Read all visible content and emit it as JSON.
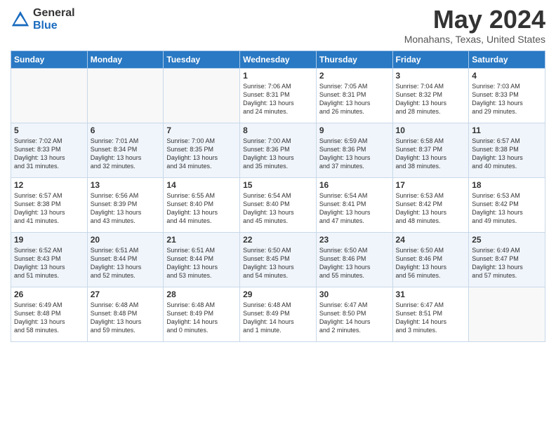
{
  "header": {
    "logo_general": "General",
    "logo_blue": "Blue",
    "title": "May 2024",
    "location": "Monahans, Texas, United States"
  },
  "days_of_week": [
    "Sunday",
    "Monday",
    "Tuesday",
    "Wednesday",
    "Thursday",
    "Friday",
    "Saturday"
  ],
  "weeks": [
    [
      {
        "day": "",
        "info": ""
      },
      {
        "day": "",
        "info": ""
      },
      {
        "day": "",
        "info": ""
      },
      {
        "day": "1",
        "info": "Sunrise: 7:06 AM\nSunset: 8:31 PM\nDaylight: 13 hours\nand 24 minutes."
      },
      {
        "day": "2",
        "info": "Sunrise: 7:05 AM\nSunset: 8:31 PM\nDaylight: 13 hours\nand 26 minutes."
      },
      {
        "day": "3",
        "info": "Sunrise: 7:04 AM\nSunset: 8:32 PM\nDaylight: 13 hours\nand 28 minutes."
      },
      {
        "day": "4",
        "info": "Sunrise: 7:03 AM\nSunset: 8:33 PM\nDaylight: 13 hours\nand 29 minutes."
      }
    ],
    [
      {
        "day": "5",
        "info": "Sunrise: 7:02 AM\nSunset: 8:33 PM\nDaylight: 13 hours\nand 31 minutes."
      },
      {
        "day": "6",
        "info": "Sunrise: 7:01 AM\nSunset: 8:34 PM\nDaylight: 13 hours\nand 32 minutes."
      },
      {
        "day": "7",
        "info": "Sunrise: 7:00 AM\nSunset: 8:35 PM\nDaylight: 13 hours\nand 34 minutes."
      },
      {
        "day": "8",
        "info": "Sunrise: 7:00 AM\nSunset: 8:36 PM\nDaylight: 13 hours\nand 35 minutes."
      },
      {
        "day": "9",
        "info": "Sunrise: 6:59 AM\nSunset: 8:36 PM\nDaylight: 13 hours\nand 37 minutes."
      },
      {
        "day": "10",
        "info": "Sunrise: 6:58 AM\nSunset: 8:37 PM\nDaylight: 13 hours\nand 38 minutes."
      },
      {
        "day": "11",
        "info": "Sunrise: 6:57 AM\nSunset: 8:38 PM\nDaylight: 13 hours\nand 40 minutes."
      }
    ],
    [
      {
        "day": "12",
        "info": "Sunrise: 6:57 AM\nSunset: 8:38 PM\nDaylight: 13 hours\nand 41 minutes."
      },
      {
        "day": "13",
        "info": "Sunrise: 6:56 AM\nSunset: 8:39 PM\nDaylight: 13 hours\nand 43 minutes."
      },
      {
        "day": "14",
        "info": "Sunrise: 6:55 AM\nSunset: 8:40 PM\nDaylight: 13 hours\nand 44 minutes."
      },
      {
        "day": "15",
        "info": "Sunrise: 6:54 AM\nSunset: 8:40 PM\nDaylight: 13 hours\nand 45 minutes."
      },
      {
        "day": "16",
        "info": "Sunrise: 6:54 AM\nSunset: 8:41 PM\nDaylight: 13 hours\nand 47 minutes."
      },
      {
        "day": "17",
        "info": "Sunrise: 6:53 AM\nSunset: 8:42 PM\nDaylight: 13 hours\nand 48 minutes."
      },
      {
        "day": "18",
        "info": "Sunrise: 6:53 AM\nSunset: 8:42 PM\nDaylight: 13 hours\nand 49 minutes."
      }
    ],
    [
      {
        "day": "19",
        "info": "Sunrise: 6:52 AM\nSunset: 8:43 PM\nDaylight: 13 hours\nand 51 minutes."
      },
      {
        "day": "20",
        "info": "Sunrise: 6:51 AM\nSunset: 8:44 PM\nDaylight: 13 hours\nand 52 minutes."
      },
      {
        "day": "21",
        "info": "Sunrise: 6:51 AM\nSunset: 8:44 PM\nDaylight: 13 hours\nand 53 minutes."
      },
      {
        "day": "22",
        "info": "Sunrise: 6:50 AM\nSunset: 8:45 PM\nDaylight: 13 hours\nand 54 minutes."
      },
      {
        "day": "23",
        "info": "Sunrise: 6:50 AM\nSunset: 8:46 PM\nDaylight: 13 hours\nand 55 minutes."
      },
      {
        "day": "24",
        "info": "Sunrise: 6:50 AM\nSunset: 8:46 PM\nDaylight: 13 hours\nand 56 minutes."
      },
      {
        "day": "25",
        "info": "Sunrise: 6:49 AM\nSunset: 8:47 PM\nDaylight: 13 hours\nand 57 minutes."
      }
    ],
    [
      {
        "day": "26",
        "info": "Sunrise: 6:49 AM\nSunset: 8:48 PM\nDaylight: 13 hours\nand 58 minutes."
      },
      {
        "day": "27",
        "info": "Sunrise: 6:48 AM\nSunset: 8:48 PM\nDaylight: 13 hours\nand 59 minutes."
      },
      {
        "day": "28",
        "info": "Sunrise: 6:48 AM\nSunset: 8:49 PM\nDaylight: 14 hours\nand 0 minutes."
      },
      {
        "day": "29",
        "info": "Sunrise: 6:48 AM\nSunset: 8:49 PM\nDaylight: 14 hours\nand 1 minute."
      },
      {
        "day": "30",
        "info": "Sunrise: 6:47 AM\nSunset: 8:50 PM\nDaylight: 14 hours\nand 2 minutes."
      },
      {
        "day": "31",
        "info": "Sunrise: 6:47 AM\nSunset: 8:51 PM\nDaylight: 14 hours\nand 3 minutes."
      },
      {
        "day": "",
        "info": ""
      }
    ]
  ]
}
